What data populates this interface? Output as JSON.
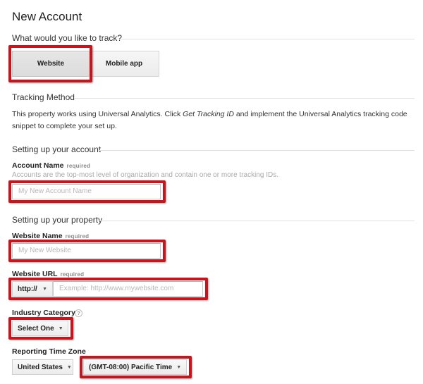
{
  "page": {
    "title": "New Account"
  },
  "track": {
    "heading": "What would you like to track?",
    "options": [
      "Website",
      "Mobile app"
    ],
    "selected": "Website"
  },
  "tracking_method": {
    "heading": "Tracking Method",
    "text_before": "This property works using Universal Analytics. Click ",
    "emphasis": "Get Tracking ID",
    "text_after": " and implement the Universal Analytics tracking code snippet to complete your set up."
  },
  "account": {
    "heading": "Setting up your account",
    "name_label": "Account Name",
    "required": "required",
    "help": "Accounts are the top-most level of organization and contain one or more tracking IDs.",
    "name_placeholder": "My New Account Name"
  },
  "property": {
    "heading": "Setting up your property",
    "website_name_label": "Website Name",
    "website_name_required": "required",
    "website_name_placeholder": "My New Website",
    "website_url_label": "Website URL",
    "website_url_required": "required",
    "protocol_value": "http://",
    "url_placeholder": "Example: http://www.mywebsite.com",
    "industry_label": "Industry Category",
    "industry_help_icon": "?",
    "industry_value": "Select One",
    "timezone_label": "Reporting Time Zone",
    "country_value": "United States",
    "timezone_value": "(GMT-08:00) Pacific Time"
  },
  "icons": {
    "caret": "▼",
    "help": "question-circle-icon",
    "dropdown": "caret-down-icon"
  },
  "colors": {
    "highlight": "#c8141c",
    "divider": "#e2e2e2",
    "placeholder": "#b8b8b8"
  }
}
